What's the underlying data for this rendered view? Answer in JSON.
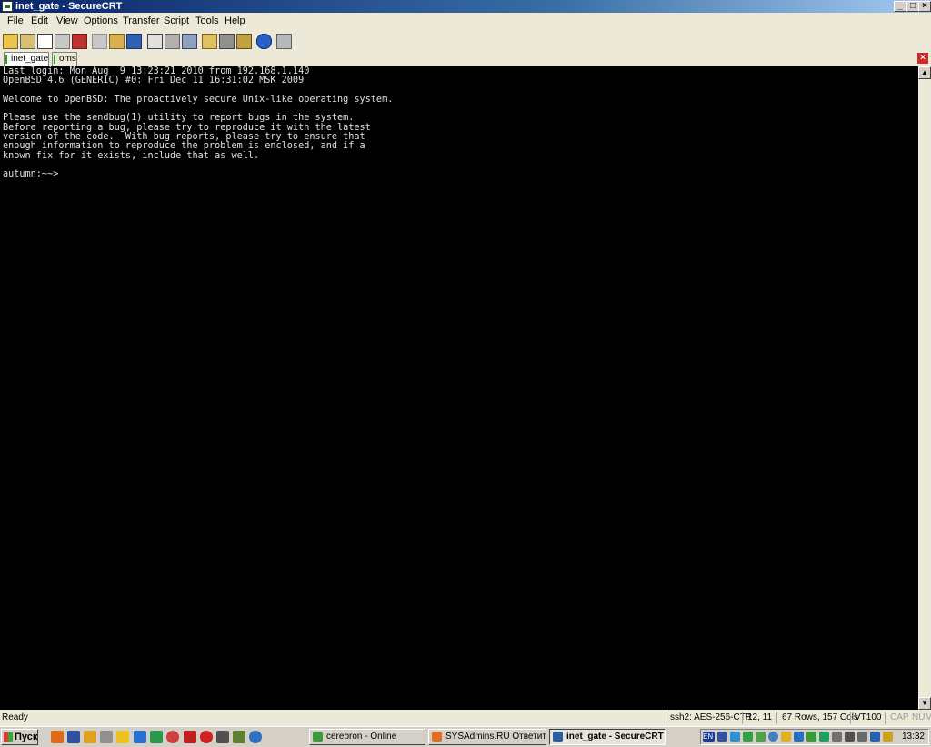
{
  "window": {
    "title": "inet_gate - SecureCRT"
  },
  "window_controls": {
    "minimize": "_",
    "maximize": "□",
    "close": "×"
  },
  "menu": [
    "File",
    "Edit",
    "View",
    "Options",
    "Transfer",
    "Script",
    "Tools",
    "Help"
  ],
  "tabs": [
    {
      "label": "inet_gate",
      "active": true
    },
    {
      "label": "oms",
      "active": false
    }
  ],
  "terminal": {
    "lines": [
      "Last login: Mon Aug  9 13:23:21 2010 from 192.168.1.140",
      "OpenBSD 4.6 (GENERIC) #0: Fri Dec 11 16:31:02 MSK 2009",
      "",
      "Welcome to OpenBSD: The proactively secure Unix-like operating system.",
      "",
      "Please use the sendbug(1) utility to report bugs in the system.",
      "Before reporting a bug, please try to reproduce it with the latest",
      "version of the code.  With bug reports, please try to ensure that",
      "enough information to reproduce the problem is enclosed, and if a",
      "known fix for it exists, include that as well.",
      "",
      "autumn:~~>"
    ]
  },
  "status": {
    "ready": "Ready",
    "cipher": "ssh2: AES-256-CTR",
    "cursor": "12, 11",
    "size": "67 Rows, 157 Cols",
    "emulation": "VT100",
    "caps": "CAP",
    "num": "NUM"
  },
  "taskbar": {
    "start": "Пуск",
    "tasks": [
      {
        "label": "cerebron - Online",
        "color": "#3c9a3c"
      },
      {
        "label": "SYSAdmins.RU Ответит...",
        "color": "#e07020"
      },
      {
        "label": "inet_gate - SecureCRT",
        "color": "#2a5ea0",
        "active": true
      }
    ],
    "lang": "EN",
    "clock": "13:32"
  }
}
